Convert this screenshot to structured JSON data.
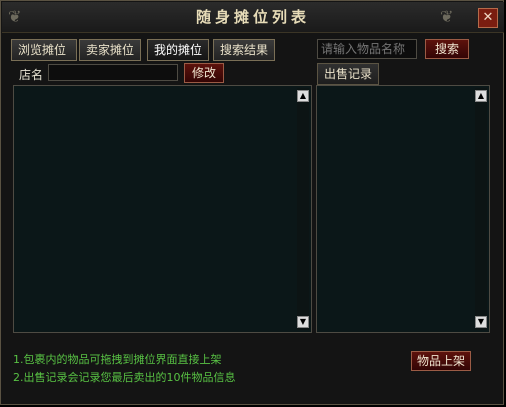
{
  "window": {
    "title": "随身摊位列表",
    "close_glyph": "✕"
  },
  "tabs": [
    {
      "label": "浏览摊位",
      "active": false
    },
    {
      "label": "卖家摊位",
      "active": false
    },
    {
      "label": "我的摊位",
      "active": true
    },
    {
      "label": "搜索结果",
      "active": false
    }
  ],
  "search": {
    "placeholder": "请输入物品名称",
    "button_label": "搜索"
  },
  "shop": {
    "name_label": "店名",
    "name_value": "",
    "edit_button": "修改"
  },
  "sales": {
    "header": "出售记录"
  },
  "footer": {
    "tips": [
      "1.包裹内的物品可拖拽到摊位界面直接上架",
      "2.出售记录会记录您最后卖出的10件物品信息"
    ],
    "list_button": "物品上架"
  },
  "colors": {
    "accent_button": "#5d120c",
    "tip_text": "#58c244",
    "panel_bg": "#0b1718"
  }
}
